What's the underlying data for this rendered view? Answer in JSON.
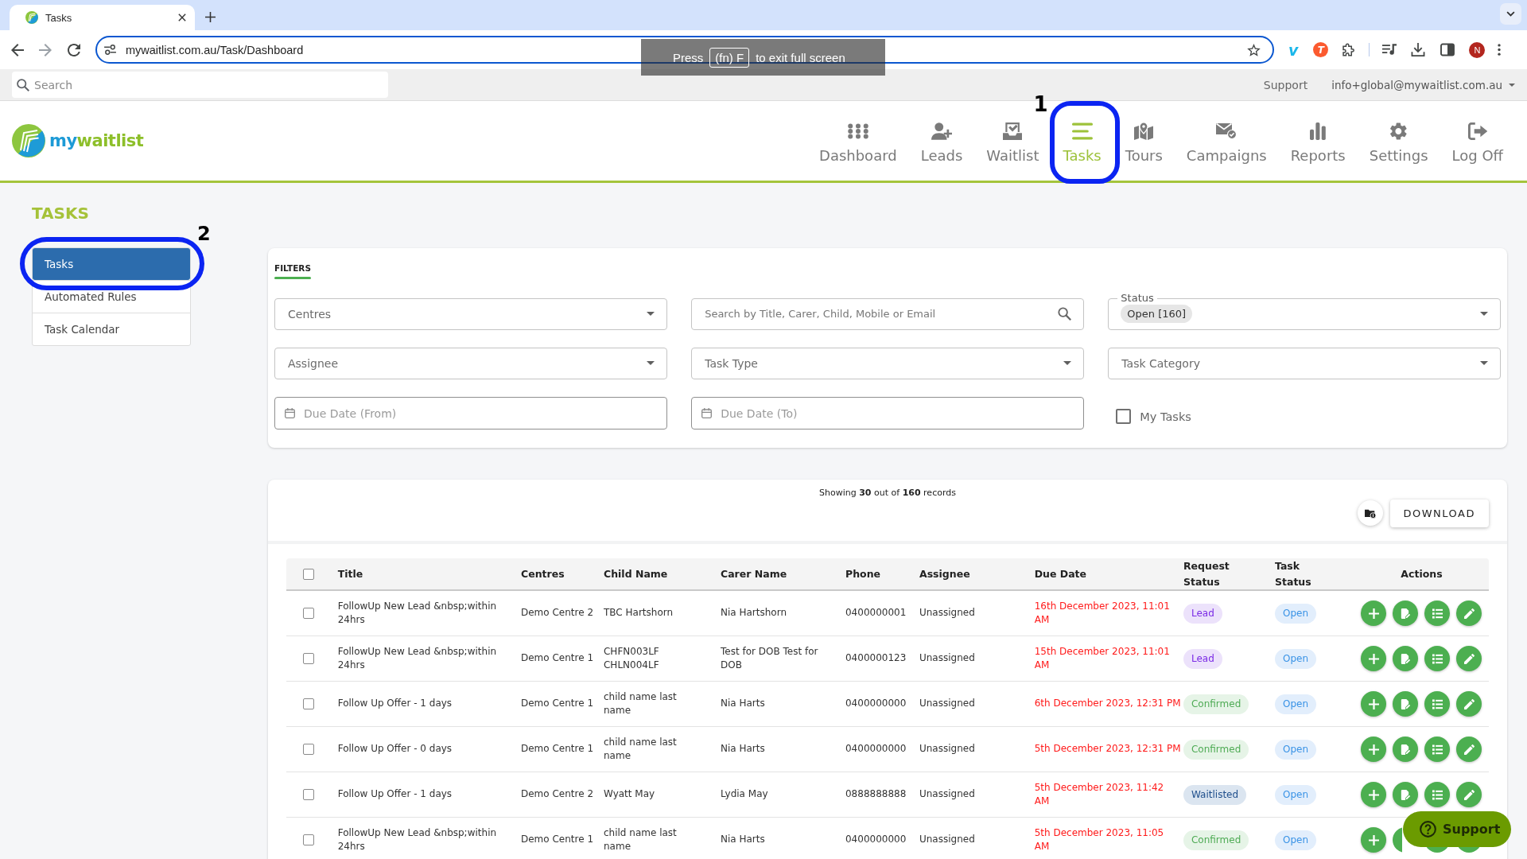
{
  "browser": {
    "tab": {
      "title": "Tasks"
    },
    "url": "mywaitlist.com.au/Task/Dashboard",
    "fullscreen_notice": {
      "before": "Press",
      "key": "(fn) F",
      "after": "to exit full screen"
    },
    "extension_letters": [
      "v",
      "T"
    ],
    "profile_initial": "N"
  },
  "top_bar": {
    "search": {
      "placeholder": "Search"
    },
    "link": "Support",
    "account": "info+global@mywaitlist.com.au"
  },
  "header": {
    "logo": [
      "my",
      "waitlist"
    ],
    "nav": [
      {
        "label": "Dashboard",
        "selected": false
      },
      {
        "label": "Leads",
        "selected": false
      },
      {
        "label": "Waitlist",
        "selected": false
      },
      {
        "label": "Tasks",
        "selected": true,
        "annotation": "1"
      },
      {
        "label": "Tours",
        "selected": false
      },
      {
        "label": "Campaigns",
        "selected": false
      },
      {
        "label": "Reports",
        "selected": false
      },
      {
        "label": "Settings",
        "selected": false
      },
      {
        "label": "Log Off",
        "selected": false
      }
    ]
  },
  "page": {
    "title": "TASKS"
  },
  "sidebar": {
    "items": [
      {
        "label": "Tasks",
        "selected": true,
        "annotation": "2"
      },
      {
        "label": "Automated Rules",
        "selected": false
      },
      {
        "label": "Task Calendar",
        "selected": false
      }
    ]
  },
  "filters": {
    "tab": {
      "label": "FILTERS",
      "selected": true
    },
    "fields": [
      {
        "kind": "select",
        "label": "Centres"
      },
      {
        "kind": "search",
        "placeholder": "Search by Title, Carer, Child, Mobile or Email"
      },
      {
        "kind": "chips",
        "label": "Status",
        "chips": [
          "Open [160]"
        ]
      },
      {
        "kind": "select",
        "label": "Assignee"
      },
      {
        "kind": "select",
        "label": "Task Type"
      },
      {
        "kind": "select",
        "label": "Task Category"
      },
      {
        "kind": "date",
        "placeholder": "Due Date (From)"
      },
      {
        "kind": "date",
        "placeholder": "Due Date (To)"
      },
      {
        "kind": "checkbox",
        "label": "My Tasks",
        "checked": false
      }
    ]
  },
  "records": {
    "summary": "Showing **30** out of **160** records",
    "download": "DOWNLOAD"
  },
  "table": {
    "select_all": {
      "checked": false
    },
    "columns": [
      "Title",
      "Centres",
      "Child Name",
      "Carer Name",
      "Phone",
      "Assignee",
      "Due Date",
      "Request Status",
      "Task Status",
      "Actions"
    ],
    "rows": [
      {
        "checked": false,
        "title": "FollowUp New Lead &nbsp;within 24hrs",
        "centre": "Demo Centre 2",
        "child": "TBC Hartshorn",
        "carer": "Nia Hartshorn",
        "phone": "0400000001",
        "assignee": "Unassigned",
        "due": "16th December 2023, 11:01 AM",
        "overdue": true,
        "request_status": {
          "label": "Lead",
          "kind": "lead"
        },
        "task_status": {
          "label": "Open",
          "kind": "open"
        }
      },
      {
        "checked": false,
        "title": "FollowUp New Lead &nbsp;within 24hrs",
        "centre": "Demo Centre 1",
        "child": "CHFN003LF CHLN004LF",
        "carer": "Test for DOB Test for DOB",
        "phone": "0400000123",
        "assignee": "Unassigned",
        "due": "15th December 2023, 11:01 AM",
        "overdue": true,
        "request_status": {
          "label": "Lead",
          "kind": "lead"
        },
        "task_status": {
          "label": "Open",
          "kind": "open"
        }
      },
      {
        "checked": false,
        "title": "Follow Up Offer - 1 days",
        "centre": "Demo Centre 1",
        "child": "child name last name",
        "carer": "Nia Harts",
        "phone": "0400000000",
        "assignee": "Unassigned",
        "due": "6th December 2023, 12:31 PM",
        "overdue": true,
        "request_status": {
          "label": "Confirmed",
          "kind": "confirmed"
        },
        "task_status": {
          "label": "Open",
          "kind": "open"
        }
      },
      {
        "checked": false,
        "title": "Follow Up Offer - 0 days",
        "centre": "Demo Centre 1",
        "child": "child name last name",
        "carer": "Nia Harts",
        "phone": "0400000000",
        "assignee": "Unassigned",
        "due": "5th December 2023, 12:31 PM",
        "overdue": true,
        "request_status": {
          "label": "Confirmed",
          "kind": "confirmed"
        },
        "task_status": {
          "label": "Open",
          "kind": "open"
        }
      },
      {
        "checked": false,
        "title": "Follow Up Offer - 1 days",
        "centre": "Demo Centre 2",
        "child": "Wyatt May",
        "carer": "Lydia May",
        "phone": "0888888888",
        "assignee": "Unassigned",
        "due": "5th December 2023, 11:42 AM",
        "overdue": true,
        "request_status": {
          "label": "Waitlisted",
          "kind": "waitlisted"
        },
        "task_status": {
          "label": "Open",
          "kind": "open"
        }
      },
      {
        "checked": false,
        "title": "FollowUp New Lead &nbsp;within 24hrs",
        "centre": "Demo Centre 1",
        "child": "child name last name",
        "carer": "Nia Harts",
        "phone": "0400000000",
        "assignee": "Unassigned",
        "due": "5th December 2023, 11:05 AM",
        "overdue": true,
        "request_status": {
          "label": "Confirmed",
          "kind": "confirmed"
        },
        "task_status": {
          "label": "Open",
          "kind": "open"
        }
      }
    ]
  },
  "support_button": "Support"
}
